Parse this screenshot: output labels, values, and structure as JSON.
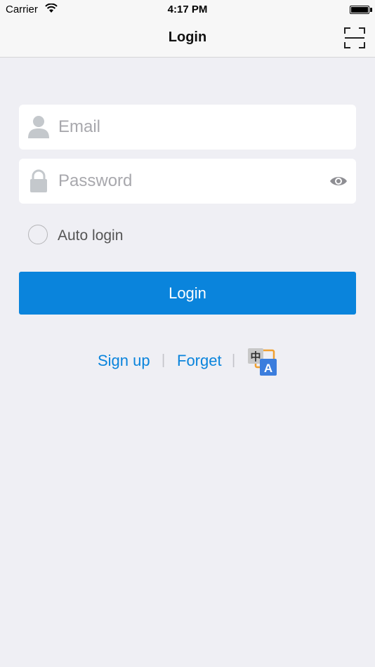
{
  "status_bar": {
    "carrier": "Carrier",
    "time": "4:17 PM"
  },
  "nav": {
    "title": "Login"
  },
  "form": {
    "email_placeholder": "Email",
    "password_placeholder": "Password",
    "auto_login_label": "Auto login",
    "login_button": "Login"
  },
  "links": {
    "signup": "Sign up",
    "forget": "Forget",
    "separator": "|",
    "language_glyph_cn": "中",
    "language_glyph_en": "A"
  },
  "colors": {
    "accent": "#0a84dc",
    "background": "#efeff4",
    "placeholder": "#a8a8ad"
  },
  "icons": [
    "wifi-icon",
    "battery-icon",
    "scan-icon",
    "user-icon",
    "lock-icon",
    "eye-icon",
    "language-icon"
  ]
}
